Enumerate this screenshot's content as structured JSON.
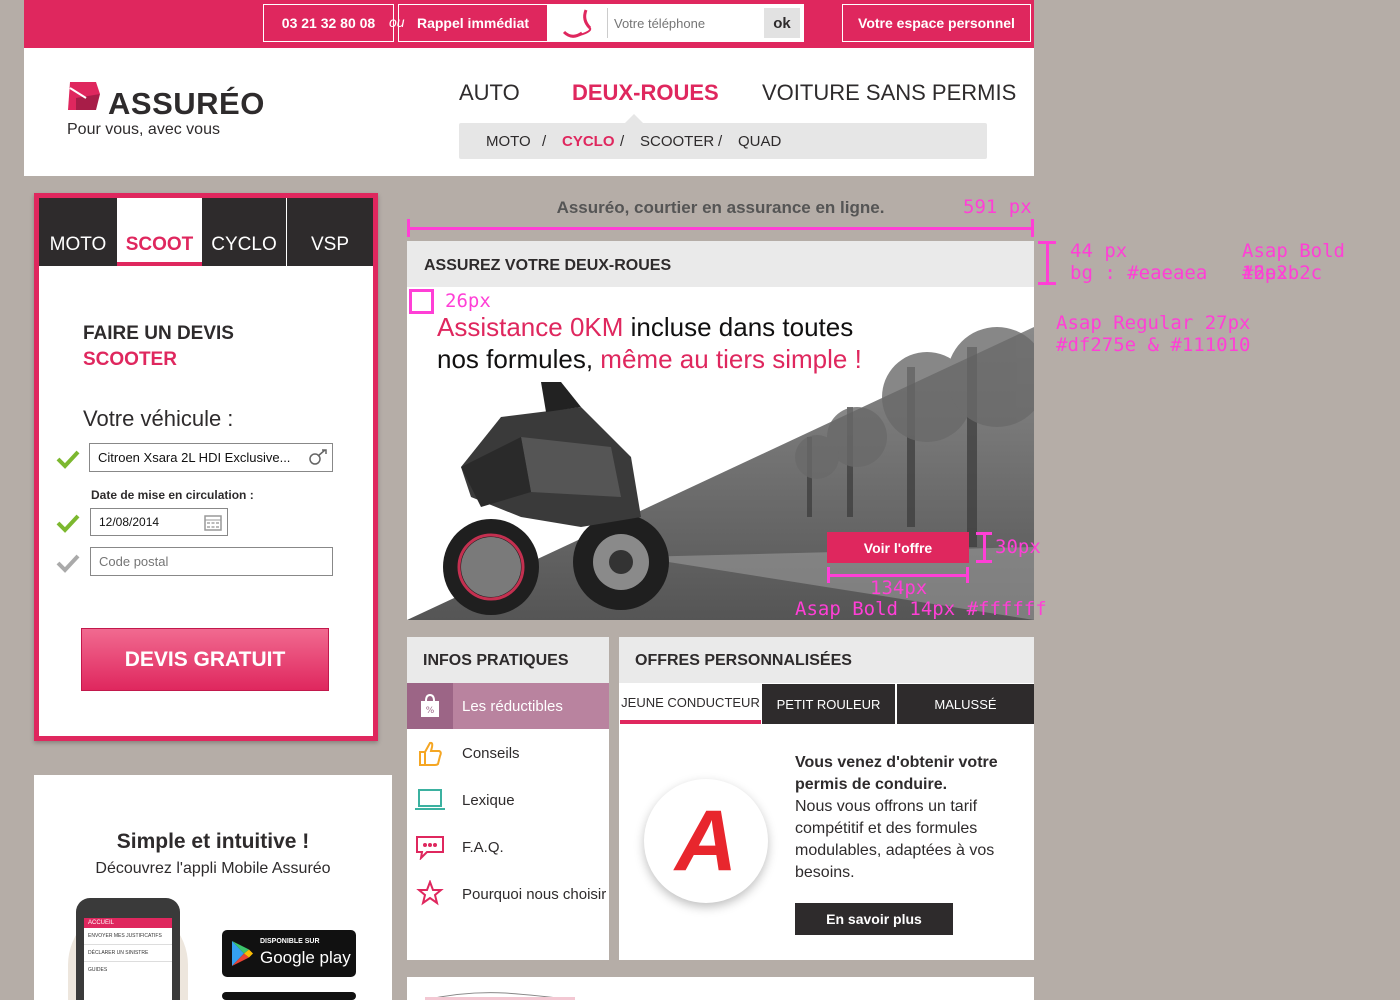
{
  "topbar": {
    "phone": "03 21 32 80 08",
    "ou": "ou",
    "rappel_label": "Rappel immédiat",
    "phone_placeholder": "Votre téléphone",
    "ok_label": "ok",
    "espace_label": "Votre espace personnel"
  },
  "header": {
    "logo_text": "ASSURÉO",
    "tagline": "Pour vous, avec vous",
    "nav": [
      {
        "label": "AUTO",
        "active": false
      },
      {
        "label": "DEUX-ROUES",
        "active": true
      },
      {
        "label": "VOITURE SANS PERMIS",
        "active": false
      }
    ],
    "subnav": [
      {
        "label": "MOTO",
        "active": false
      },
      {
        "label": "CYCLO",
        "active": true
      },
      {
        "label": "SCOOTER",
        "active": false
      },
      {
        "label": "QUAD",
        "active": false
      }
    ],
    "subnav_separator": "/"
  },
  "form": {
    "tabs": [
      {
        "label": "MOTO",
        "active": false
      },
      {
        "label": "SCOOT",
        "active": true
      },
      {
        "label": "CYCLO",
        "active": false
      },
      {
        "label": "VSP",
        "active": false
      }
    ],
    "title_line1": "FAIRE UN DEVIS",
    "title_line2": "SCOOTER",
    "vehicule_label": "Votre véhicule :",
    "vehicule_value": "Citroen Xsara 2L HDI Exclusive...",
    "date_label": "Date de mise en circulation :",
    "date_value": "12/08/2014",
    "postal_placeholder": "Code postal",
    "cta_label": "DEVIS GRATUIT"
  },
  "app": {
    "title": "Simple et intuitive !",
    "subtitle": "Découvrez l'appli Mobile Assuréo",
    "google_small": "DISPONIBLE SUR",
    "google_big": "Google play",
    "phone_screen": [
      "ACCUEIL",
      "ENVOYER MES JUSTIFICATIFS",
      "DÉCLARER UN SINISTRE",
      "GUIDES"
    ]
  },
  "banner": {
    "courtier": "Assuréo, courtier en assurance en ligne.",
    "head": "ASSUREZ VOTRE DEUX-ROUES",
    "line1_pink": "Assistance 0KM",
    "line1_dark": " incluse dans toutes",
    "line2_dark": "nos formules, ",
    "line2_pink": "même au tiers simple !",
    "cta_label": "Voir l'offre"
  },
  "infos": {
    "head": "INFOS PRATIQUES",
    "items": [
      {
        "label": "Les réductibles",
        "icon": "shopping-bag-percent-icon",
        "active": true
      },
      {
        "label": "Conseils",
        "icon": "thumbs-up-icon",
        "active": false
      },
      {
        "label": "Lexique",
        "icon": "laptop-icon",
        "active": false
      },
      {
        "label": "F.A.Q.",
        "icon": "chat-bubble-icon",
        "active": false
      },
      {
        "label": "Pourquoi nous choisir",
        "icon": "stars-icon",
        "active": false
      }
    ]
  },
  "offres": {
    "head": "OFFRES PERSONNALISÉES",
    "tabs": [
      {
        "label": "JEUNE CONDUCTEUR",
        "active": true
      },
      {
        "label": "PETIT ROULEUR",
        "active": false
      },
      {
        "label": "MALUSSÉ",
        "active": false
      }
    ],
    "badge_letter": "A",
    "bold_text": "Vous venez d'obtenir votre permis de conduire.",
    "text": "Nous vous offrons un tarif compétitif et des formules modulables, adaptées à vos besoins.",
    "cta_label": "En savoir plus"
  },
  "annotations": {
    "width_591": "591 px",
    "height_44": "44 px",
    "bg_eaeaea": "bg : #eaeaea",
    "font_asap_bold_16": "Asap Bold 16px",
    "color_2e2b2c": "#2e2b2c",
    "size_26": "26px",
    "font_asap_regular_27": "Asap Regular 27px",
    "colors_banner": "#df275e & #111010",
    "size_30": "30px",
    "width_134": "134px",
    "font_asap_bold_14": "Asap Bold 14px #ffffff"
  },
  "colors": {
    "brand_pink": "#df275e",
    "dark": "#2e2b2c",
    "panel_grey": "#eaeaea",
    "page_bg": "#b5ada7",
    "annotation": "#ff3fd6"
  }
}
